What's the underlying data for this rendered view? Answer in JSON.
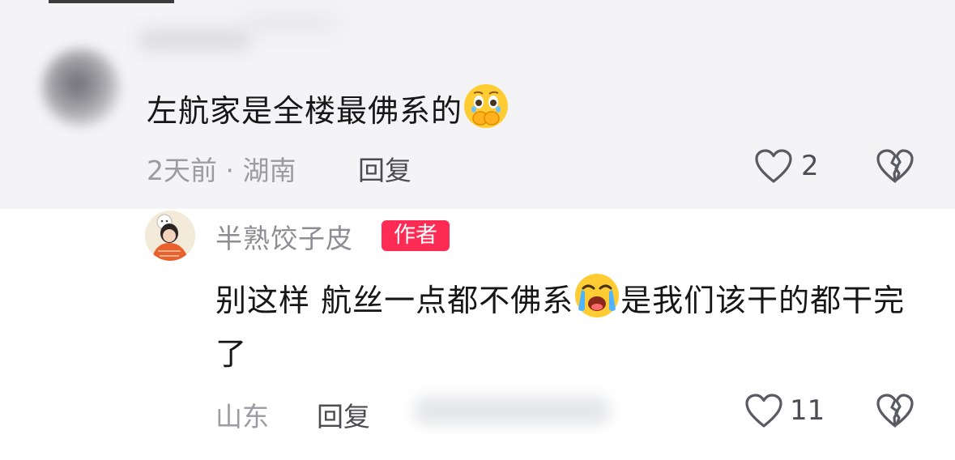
{
  "comments": [
    {
      "user": "",
      "text_before_emoji": "左航家是全楼最佛系的",
      "text_after_emoji": "",
      "emoji": "face-holding-back-tears",
      "time_location": "2天前 · 湖南",
      "reply_label": "回复",
      "like_count": "2"
    },
    {
      "user": "半熟饺子皮",
      "author_badge": "作者",
      "text_before_emoji": "别这样 航丝一点都不佛系",
      "text_after_emoji": "是我们该干的都干完了",
      "emoji": "loudly-crying-face",
      "time_location": "山东",
      "reply_label": "回复",
      "like_count": "11"
    }
  ],
  "colors": {
    "highlight_bg": "#f4f4f6",
    "author_badge_bg": "#fe2c55",
    "meta_text": "#9b9ba1"
  }
}
